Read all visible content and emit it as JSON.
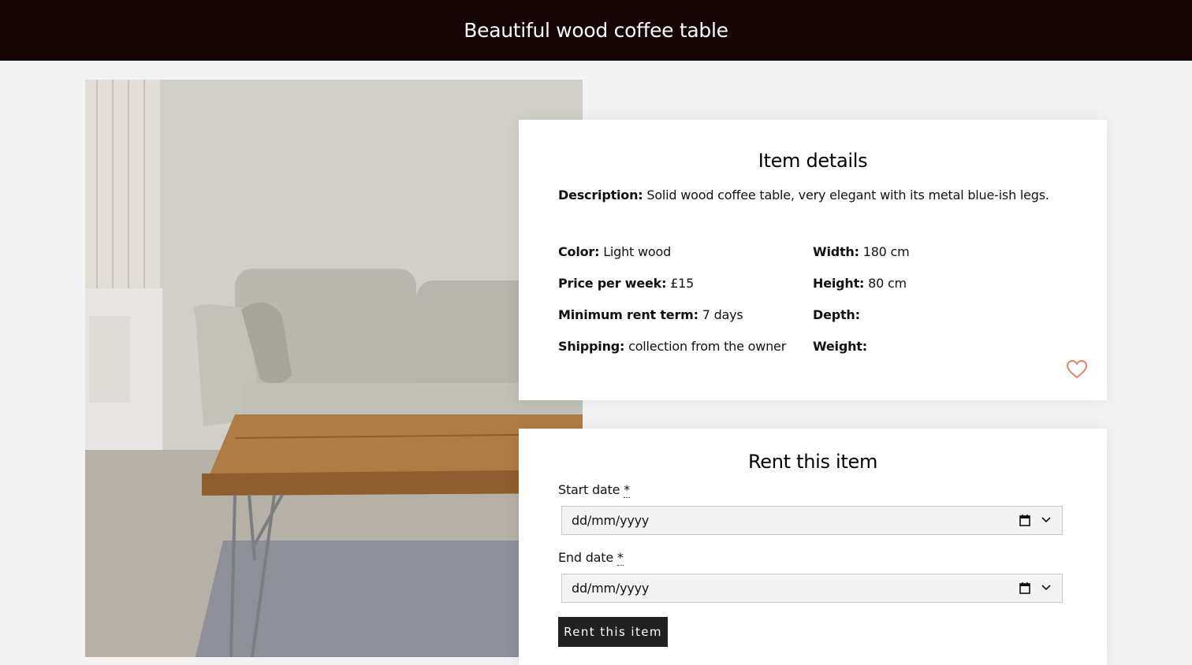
{
  "header": {
    "title": "Beautiful wood coffee table"
  },
  "details": {
    "title": "Item details",
    "description_label": "Description:",
    "description_value": "Solid wood coffee table, very elegant with its metal blue-ish legs.",
    "left_attributes": [
      {
        "label": "Color:",
        "value": "Light wood"
      },
      {
        "label": "Price per week:",
        "value": "£15"
      },
      {
        "label": "Minimum rent term:",
        "value": "7 days"
      },
      {
        "label": "Shipping:",
        "value": "collection from the owner"
      }
    ],
    "right_attributes": [
      {
        "label": "Width:",
        "value": "180 cm"
      },
      {
        "label": "Height:",
        "value": "80 cm"
      },
      {
        "label": "Depth:",
        "value": ""
      },
      {
        "label": "Weight:",
        "value": ""
      }
    ],
    "favorite_icon": "heart-icon",
    "accent_color": "#e8806a"
  },
  "rent": {
    "title": "Rent this item",
    "start_label": "Start date",
    "end_label": "End date",
    "required_marker": "*",
    "start_placeholder": "dd/mm/yyyy",
    "end_placeholder": "dd/mm/yyyy",
    "button_label": "Rent this item"
  }
}
